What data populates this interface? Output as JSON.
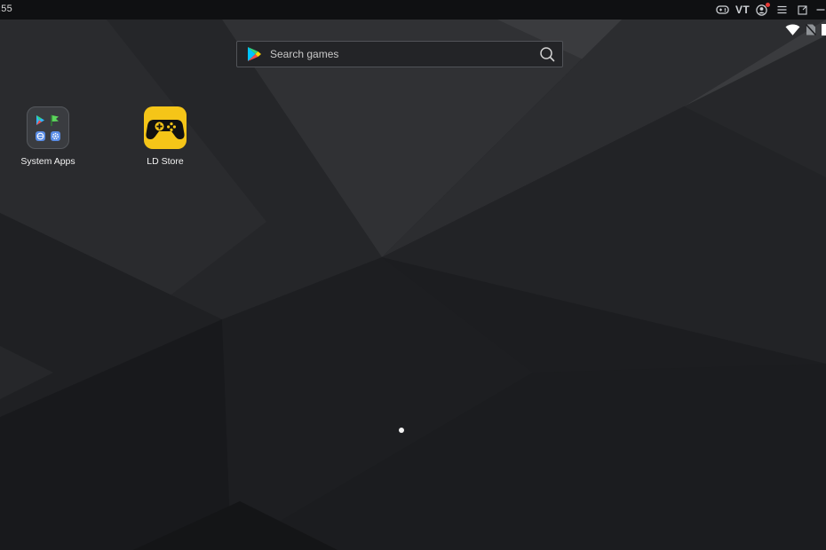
{
  "titlebar": {
    "time": ":55",
    "vt_label": "VT"
  },
  "search": {
    "placeholder": "Search games"
  },
  "apps": [
    {
      "label": "System Apps"
    },
    {
      "label": "LD Store"
    }
  ],
  "colors": {
    "accent_yellow": "#f5c518",
    "notification_red": "#e53935",
    "background": "#1b1c1f"
  },
  "icons": {
    "gamepad": "gamepad-icon",
    "account": "account-icon",
    "menu": "menu-icon",
    "window": "window-icon",
    "minimize": "minimize-icon",
    "wifi": "wifi-icon",
    "no_sim": "no-sim-icon",
    "play_store": "play-store-icon",
    "search": "search-icon"
  }
}
